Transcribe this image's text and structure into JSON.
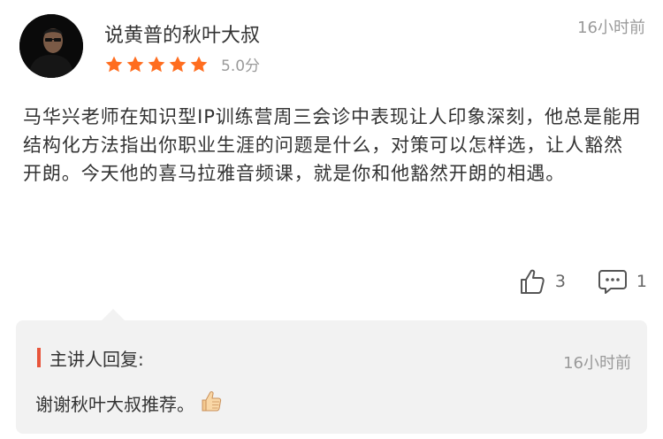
{
  "comment": {
    "username": "说黄普的秋叶大叔",
    "timestamp": "16小时前",
    "rating": {
      "stars": 5,
      "max": 5,
      "score_text": "5.0分"
    },
    "text": "马华兴老师在知识型IP训练营周三会诊中表现让人印象深刻，他总是能用结构化方法指出你职业生涯的问题是什么，对策可以怎样选，让人豁然开朗。今天他的喜马拉雅音频课，就是你和他豁然开朗的相遇。",
    "like_count": "3",
    "comment_count": "1"
  },
  "reply": {
    "label": "主讲人回复:",
    "timestamp": "16小时前",
    "text": "谢谢秋叶大叔推荐。",
    "emoji": "thumbs-up-emoji"
  },
  "colors": {
    "star": "#ff6d1f",
    "accent_bar": "#e8553b",
    "muted_text": "#9a9a9a",
    "reply_bg": "#f2f2f2"
  }
}
